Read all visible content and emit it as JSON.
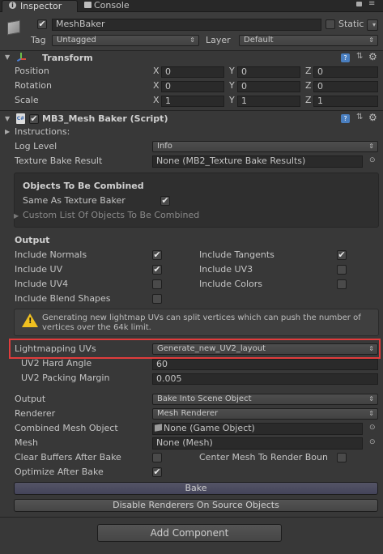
{
  "tabs": [
    {
      "label": "Inspector",
      "icon": "info-icon"
    },
    {
      "label": "Console",
      "icon": "console-icon"
    }
  ],
  "object": {
    "name": "MeshBaker",
    "active": true,
    "static_label": "Static",
    "tag_label": "Tag",
    "tag_value": "Untagged",
    "layer_label": "Layer",
    "layer_value": "Default"
  },
  "transform": {
    "title": "Transform",
    "rows": [
      {
        "label": "Position",
        "x": "0",
        "y": "0",
        "z": "0"
      },
      {
        "label": "Rotation",
        "x": "0",
        "y": "0",
        "z": "0"
      },
      {
        "label": "Scale",
        "x": "1",
        "y": "1",
        "z": "1"
      }
    ],
    "axis": {
      "x": "X",
      "y": "Y",
      "z": "Z"
    }
  },
  "script": {
    "title": "MB3_Mesh Baker (Script)",
    "icon_text": "C#",
    "instructions": "Instructions:",
    "log_level_label": "Log Level",
    "log_level_value": "Info",
    "texture_bake_label": "Texture Bake Result",
    "texture_bake_value": "None (MB2_Texture Bake Results)",
    "objects_title": "Objects To Be Combined",
    "same_as_label": "Same As Texture Baker",
    "same_as_checked": true,
    "custom_list_label": "Custom List Of Objects To Be Combined",
    "output_title": "Output",
    "options": [
      {
        "label": "Include Normals",
        "checked": true
      },
      {
        "label": "Include Tangents",
        "checked": true
      },
      {
        "label": "Include UV",
        "checked": true
      },
      {
        "label": "Include UV3",
        "checked": false
      },
      {
        "label": "Include UV4",
        "checked": false
      },
      {
        "label": "Include Colors",
        "checked": false
      },
      {
        "label": "Include Blend Shapes",
        "checked": false
      }
    ],
    "warning": "Generating new lightmap UVs can split vertices which can push the number of vertices over the 64k limit.",
    "lightmapping_label": "Lightmapping UVs",
    "lightmapping_value": "Generate_new_UV2_layout",
    "uv2_angle_label": "UV2 Hard Angle",
    "uv2_angle_value": "60",
    "uv2_margin_label": "UV2 Packing Margin",
    "uv2_margin_value": "0.005",
    "output_label": "Output",
    "output_value": "Bake Into Scene Object",
    "renderer_label": "Renderer",
    "renderer_value": "Mesh Renderer",
    "combined_label": "Combined Mesh Object",
    "combined_value": "None (Game Object)",
    "mesh_label": "Mesh",
    "mesh_value": "None (Mesh)",
    "clear_buffers_label": "Clear Buffers After Bake",
    "clear_buffers_checked": false,
    "center_mesh_label": "Center Mesh To Render Boun",
    "center_mesh_checked": false,
    "optimize_label": "Optimize After Bake",
    "optimize_checked": true,
    "bake_button": "Bake",
    "disable_button": "Disable Renderers On Source Objects"
  },
  "add_component": "Add Component",
  "colors": {
    "highlight_border": "#e03c3c",
    "bake_button_tint": "#4a4a5a"
  }
}
